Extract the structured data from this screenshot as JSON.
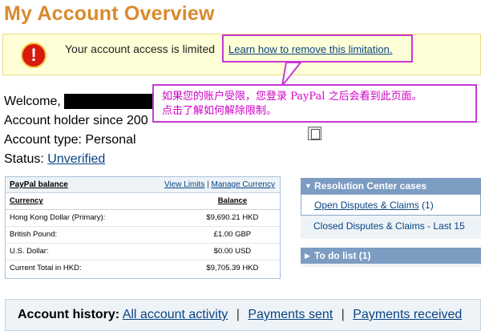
{
  "page": {
    "title": "My Account Overview"
  },
  "limit_banner": {
    "message": "Your account access is limited",
    "link_label": "Learn how to remove this limitation."
  },
  "callout": {
    "line1": "如果您的账户受限，您登录 PayPal 之后会看到此页面。",
    "line2": "点击了解如何解除限制。"
  },
  "account": {
    "welcome_label": "Welcome,",
    "holder_since_label": "Account holder since 200",
    "type_label": "Account type:",
    "type_value": "Personal",
    "status_label": "Status:",
    "status_value": "Unverified"
  },
  "balance": {
    "title": "PayPal balance",
    "view_limits": "View Limits",
    "link_separator": "|",
    "manage_currency": "Manage Currency",
    "columns": [
      "Currency",
      "Balance"
    ],
    "rows": [
      {
        "currency": "Hong Kong Dollar (Primary):",
        "amount": "$9,690.21 HKD"
      },
      {
        "currency": "British Pound:",
        "amount": "£1.00 GBP"
      },
      {
        "currency": "U.S. Dollar:",
        "amount": "$0.00 USD"
      },
      {
        "currency": "Current Total in HKD:",
        "amount": "$9,705.39 HKD"
      }
    ]
  },
  "resolution_center": {
    "title": "Resolution Center cases",
    "open_label": "Open Disputes & Claims",
    "open_count": "(1)",
    "closed_label": "Closed Disputes & Claims - Last 15"
  },
  "todo": {
    "title": "To do list (1)"
  },
  "history": {
    "label": "Account history:",
    "separator": "|",
    "links": [
      "All account activity",
      "Payments sent",
      "Payments received"
    ]
  },
  "colors": {
    "title_orange": "#d98a2b",
    "link_blue": "#084482",
    "annotation_magenta": "#c838d6",
    "banner_yellow": "#ffffd7",
    "panel_header_blue": "#7c9cc2"
  },
  "icons": {
    "warning": "warning-icon",
    "paste": "paste-icon",
    "panel_arrow_open": "triangle-down-icon",
    "panel_arrow_closed": "triangle-right-icon"
  }
}
